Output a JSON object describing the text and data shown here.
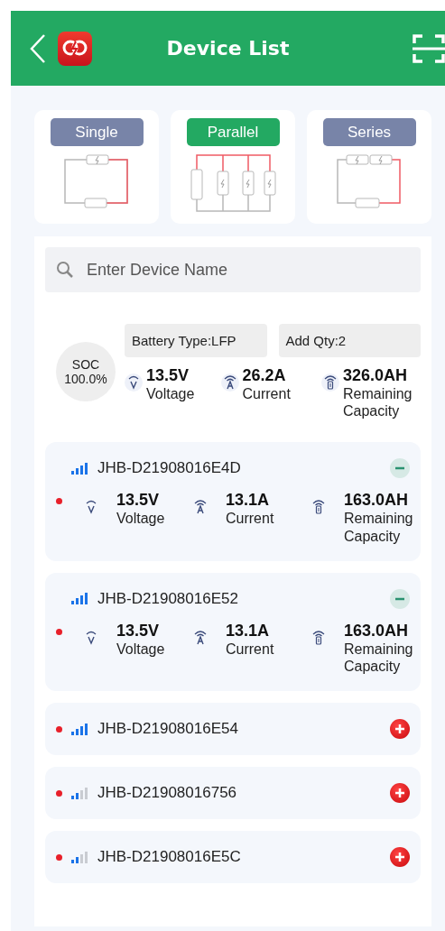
{
  "header": {
    "title": "Device List"
  },
  "modes": [
    {
      "kind": "single",
      "label": "Single",
      "selected": false
    },
    {
      "kind": "parallel",
      "label": "Parallel",
      "selected": true
    },
    {
      "kind": "series",
      "label": "Series",
      "selected": false
    }
  ],
  "search": {
    "placeholder": "Enter Device Name"
  },
  "summary": {
    "soc_label": "SOC",
    "soc_value": "100.0%",
    "battery_type": "Battery Type:LFP",
    "add_qty": "Add Qty:2",
    "metrics": [
      {
        "kind": "voltage",
        "value": "13.5V",
        "label": "Voltage"
      },
      {
        "kind": "current",
        "value": "26.2A",
        "label": "Current"
      },
      {
        "kind": "capacity",
        "value": "326.0AH",
        "label": "Remaining Capacity"
      }
    ]
  },
  "devices": [
    {
      "name": "JHB-D21908016E4D",
      "added": true,
      "weak_signal": false,
      "color": "#e8202a",
      "metrics": [
        {
          "kind": "voltage",
          "value": "13.5V",
          "label": "Voltage"
        },
        {
          "kind": "current",
          "value": "13.1A",
          "label": "Current"
        },
        {
          "kind": "capacity",
          "value": "163.0AH",
          "label": "Remaining Capacity"
        }
      ]
    },
    {
      "name": "JHB-D21908016E52",
      "added": true,
      "weak_signal": false,
      "color": "#e8202a",
      "metrics": [
        {
          "kind": "voltage",
          "value": "13.5V",
          "label": "Voltage"
        },
        {
          "kind": "current",
          "value": "13.1A",
          "label": "Current"
        },
        {
          "kind": "capacity",
          "value": "163.0AH",
          "label": "Remaining Capacity"
        }
      ]
    },
    {
      "name": "JHB-D21908016E54",
      "added": false,
      "weak_signal": false,
      "color": "#e8202a"
    },
    {
      "name": "JHB-D21908016756",
      "added": false,
      "weak_signal": true,
      "color": "#e8202a"
    },
    {
      "name": "JHB-D21908016E5C",
      "added": false,
      "weak_signal": true,
      "color": "#e8202a"
    }
  ]
}
